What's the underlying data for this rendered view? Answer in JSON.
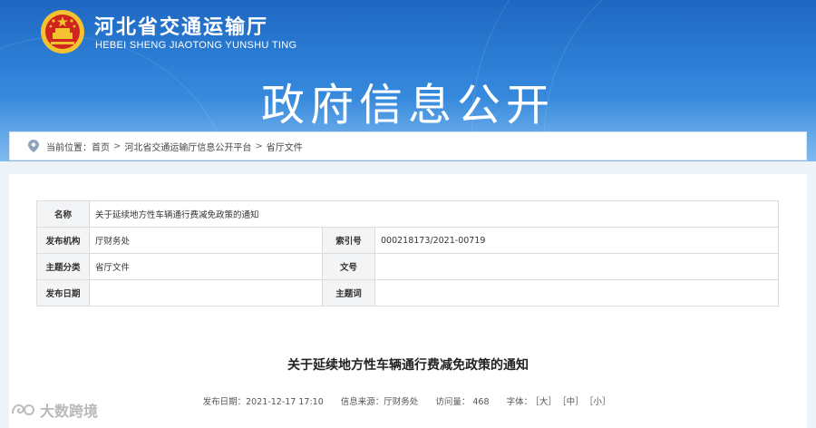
{
  "header": {
    "site_name": "河北省交通运输厅",
    "site_name_en": "HEBEI SHENG JIAOTONG YUNSHU TING",
    "section_title": "政府信息公开",
    "colors": {
      "banner_top": "#1f67c2",
      "banner_bottom": "#4d9ce6"
    }
  },
  "breadcrumb": {
    "prefix": "当前位置：",
    "items": [
      "首页",
      "河北省交通运输厅信息公开平台",
      "省厅文件"
    ],
    "separator": ">"
  },
  "meta": {
    "name_label": "名称",
    "name_value": "关于延续地方性车辆通行费减免政策的通知",
    "org_label": "发布机构",
    "org_value": "厅财务处",
    "index_label": "索引号",
    "index_value": "000218173/2021-00719",
    "topic_label": "主题分类",
    "topic_value": "省厅文件",
    "docno_label": "文号",
    "docno_value": "",
    "date_label": "发布日期",
    "date_value": "",
    "keyword_label": "主题词",
    "keyword_value": ""
  },
  "article": {
    "title": "关于延续地方性车辆通行费减免政策的通知",
    "publish_label": "发布日期：",
    "publish_value": "2021-12-17 17:10",
    "source_label": "信息来源：",
    "source_value": "厅财务处",
    "views_label": "访问量：",
    "views_value": "468",
    "font_label": "字体：",
    "font_large": "［大］",
    "font_medium": "［中］",
    "font_small": "［小］"
  },
  "watermark": {
    "text": "大数跨境"
  }
}
